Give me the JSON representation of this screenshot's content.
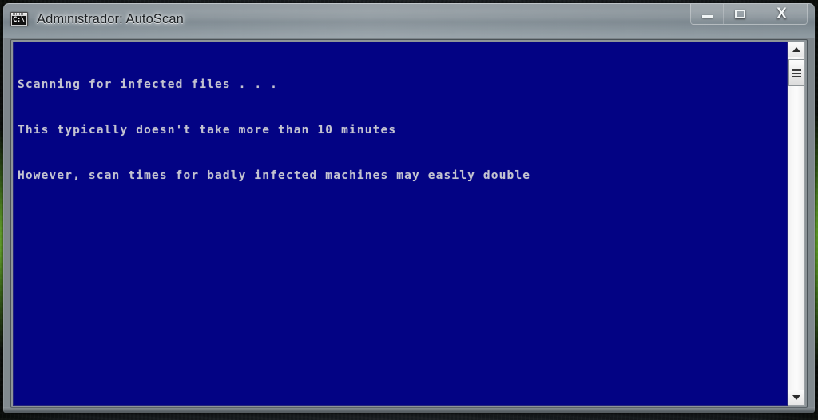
{
  "window": {
    "title": "Administrador: AutoScan",
    "icon_name": "cmd-console-icon",
    "icon_prompt": "C:\\",
    "controls": {
      "minimize_label": "Minimize",
      "maximize_label": "Maximize",
      "close_label": "Close",
      "close_glyph": "X"
    }
  },
  "console": {
    "background_color": "#030384",
    "text_color": "#c3c3d0",
    "lines": [
      "Scanning for infected files . . .",
      "This typically doesn't take more than 10 minutes",
      "However, scan times for badly infected machines may easily double"
    ]
  },
  "scrollbar": {
    "up_arrow_label": "Scroll up",
    "down_arrow_label": "Scroll down",
    "thumb_label": "Scroll thumb"
  }
}
